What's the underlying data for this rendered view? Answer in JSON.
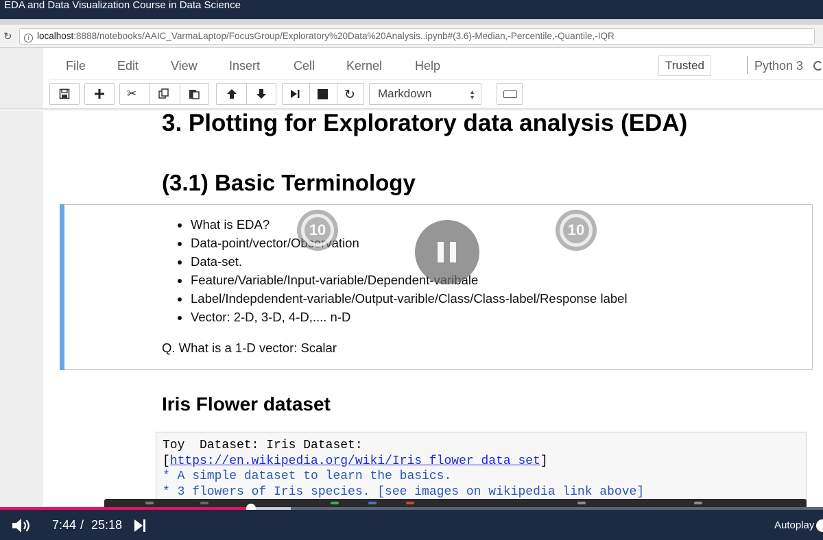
{
  "window": {
    "title": "EDA and Data Visualization Course in Data Science"
  },
  "browser": {
    "url_host": "localhost",
    "url_rest": ":8888/notebooks/AAIC_VarmaLaptop/FocusGroup/Exploratory%20Data%20Analysis..ipynb#(3.6)-Median,-Percentile,-Quantile,-IQR"
  },
  "notebook": {
    "menu": [
      "File",
      "Edit",
      "View",
      "Insert",
      "Cell",
      "Kernel",
      "Help"
    ],
    "trusted_label": "Trusted",
    "kernel_name": "Python 3",
    "cell_type": "Markdown",
    "toolbar_icons": [
      "save-icon",
      "plus-icon",
      "scissors-icon",
      "copy-icon",
      "paste-icon",
      "arrow-up-icon",
      "arrow-down-icon",
      "step-run-icon",
      "stop-icon",
      "restart-icon",
      "keyboard-icon"
    ]
  },
  "content": {
    "h1": "3. Plotting for Exploratory data analysis (EDA)",
    "h2": "(3.1) Basic Terminology",
    "bullets": [
      "What is EDA?",
      "Data-point/vector/Observation",
      "Data-set.",
      "Feature/Variable/Input-variable/Dependent-varibale",
      "Label/Indepdendent-variable/Output-varible/Class/Class-label/Response label",
      "Vector: 2-D, 3-D, 4-D,.... n-D"
    ],
    "question": "Q. What is a 1-D vector: Scalar",
    "h3": "Iris Flower dataset",
    "code": {
      "line1": "Toy  Dataset: Iris Dataset:",
      "line2_open": "[",
      "line2_link": "https://en.wikipedia.org/wiki/Iris_flower_data_set",
      "line2_close": "]",
      "line3": "* A simple dataset to learn the basics.",
      "line4": "* 3 flowers of Iris species. [see images on wikipedia link above]"
    }
  },
  "player": {
    "skip_back": "10",
    "skip_forward": "10",
    "current_time": "7:44",
    "separator": "/",
    "duration": "25:18",
    "autoplay_label": "Autoplay",
    "progress_fraction": 0.305,
    "accent_color": "#e8115d",
    "bar_color": "#1c2a43"
  }
}
